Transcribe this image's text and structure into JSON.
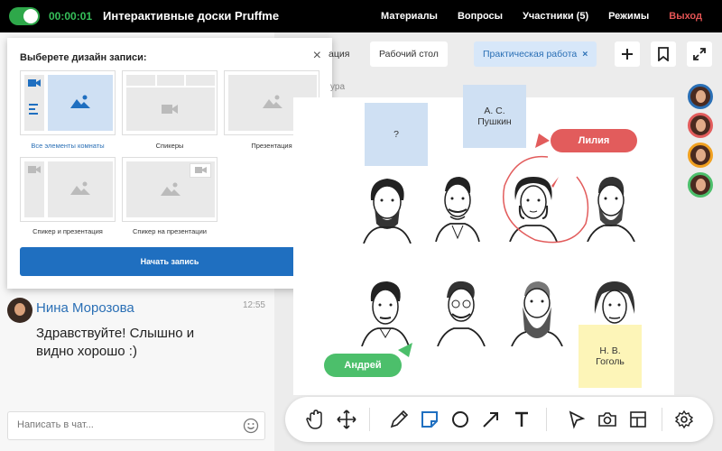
{
  "topbar": {
    "timer": "00:00:01",
    "title": "Интерактивные доски Pruffme",
    "nav": [
      "Материалы",
      "Вопросы",
      "Участники (5)",
      "Режимы"
    ],
    "exit": "Выход",
    "colors": {
      "timer": "#36c05a",
      "exit": "#e35454",
      "toggle": "#2ea84a"
    }
  },
  "modal": {
    "title": "Выберете дизайн записи:",
    "close": "×",
    "options": [
      {
        "label": "Все элементы комнаты",
        "selected": true
      },
      {
        "label": "Спикеры"
      },
      {
        "label": "Презентация"
      },
      {
        "label": "Спикер и презентация"
      },
      {
        "label": "Спикер на презентации"
      }
    ],
    "start_button": "Начать запись"
  },
  "tabs": {
    "partial": "ация",
    "desktop": "Рабочий стол",
    "practical": "Практическая работа",
    "practical_close": "×"
  },
  "board": {
    "crumb": "ура",
    "sticky_question": "?",
    "sticky_pushkin": "А. С. Пушкин",
    "sticky_gogol": "Н. В. Гоголь",
    "bubble_liliya": "Лилия",
    "bubble_andrey": "Андрей",
    "colors": {
      "liliya": "#e25c5c",
      "andrey": "#4cbf6b",
      "sticky_blue": "#cfe0f3",
      "sticky_yellow": "#fdf5b8"
    }
  },
  "chat": {
    "author": "Нина Морозова",
    "time": "12:55",
    "message": "Здравствуйте! Слышно и видно хорошо :)",
    "input_placeholder": "Написать в чат..."
  },
  "participants": [
    {
      "ring": "#2a6fb5"
    },
    {
      "ring": "#e25c5c"
    },
    {
      "ring": "#f0a020"
    },
    {
      "ring": "#4cbf6b"
    }
  ],
  "toolbar": {
    "tools": [
      "hand-icon",
      "move-icon",
      "pencil-icon",
      "sticky-note-icon",
      "circle-icon",
      "arrow-icon",
      "text-icon",
      "pointer-icon",
      "camera-icon",
      "layout-icon",
      "settings-icon"
    ]
  }
}
